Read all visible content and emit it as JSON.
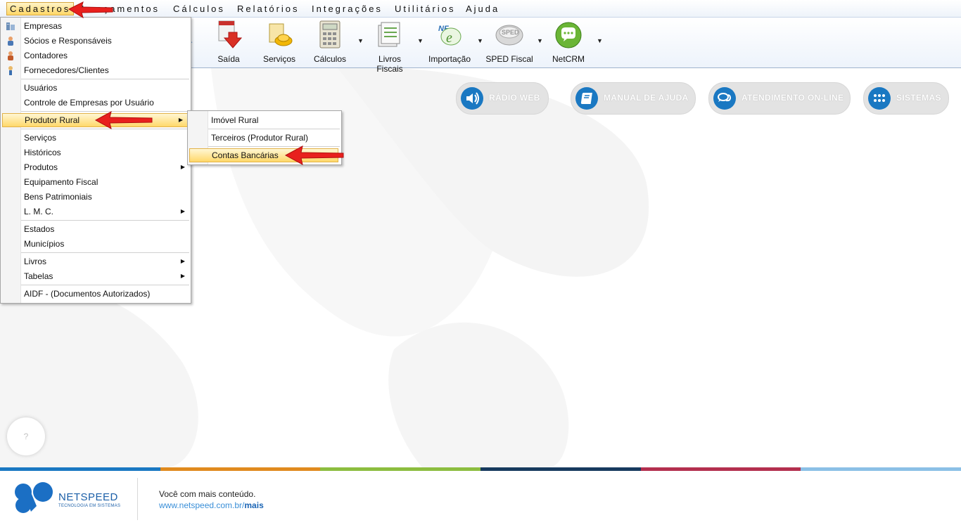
{
  "menubar": {
    "items": [
      {
        "label": "Cadastros"
      },
      {
        "label": "Lançamentos"
      },
      {
        "label": "Cálculos"
      },
      {
        "label": "Relatórios"
      },
      {
        "label": "Integrações"
      },
      {
        "label": "Utilitários"
      },
      {
        "label": "Ajuda"
      }
    ]
  },
  "toolbar": {
    "buttons": [
      {
        "label": "Saída",
        "icon": "exit-document-icon"
      },
      {
        "label": "Serviços",
        "icon": "services-icon"
      },
      {
        "label": "Cálculos",
        "icon": "calculator-icon"
      },
      {
        "label": "Livros Fiscais",
        "icon": "fiscal-books-icon"
      },
      {
        "label": "Importação",
        "icon": "nfe-import-icon"
      },
      {
        "label": "SPED Fiscal",
        "icon": "sped-disc-icon"
      },
      {
        "label": "NetCRM",
        "icon": "chat-bubble-icon"
      }
    ]
  },
  "quick_links": [
    {
      "label": "RÁDIO WEB",
      "icon": "speaker-icon"
    },
    {
      "label": "MANUAL DE AJUDA",
      "icon": "book-icon"
    },
    {
      "label": "ATENDIMENTO ON-LINE",
      "icon": "chat-icon"
    },
    {
      "label": "SISTEMAS",
      "icon": "grid-dots-icon"
    }
  ],
  "cadastros_menu": {
    "items": [
      {
        "label": "Empresas",
        "icon": "building-icon"
      },
      {
        "label": "Sócios e Responsáveis",
        "icon": "partners-icon"
      },
      {
        "label": "Contadores",
        "icon": "accountant-icon"
      },
      {
        "label": "Fornecedores/Clientes",
        "icon": "supplier-icon"
      },
      {
        "label": "Usuários"
      },
      {
        "label": "Controle de Empresas por Usuário"
      },
      {
        "label": "Produtor Rural",
        "submenu": true
      },
      {
        "label": "Serviços"
      },
      {
        "label": "Históricos"
      },
      {
        "label": "Produtos",
        "submenu": true
      },
      {
        "label": "Equipamento Fiscal"
      },
      {
        "label": "Bens Patrimoniais"
      },
      {
        "label": "L. M. C.",
        "submenu": true
      },
      {
        "label": "Estados"
      },
      {
        "label": "Municípios"
      },
      {
        "label": "Livros",
        "submenu": true
      },
      {
        "label": "Tabelas",
        "submenu": true
      },
      {
        "label": "AIDF - (Documentos Autorizados)"
      }
    ]
  },
  "produtor_rural_submenu": {
    "items": [
      {
        "label": "Imóvel Rural"
      },
      {
        "label": "Terceiros (Produtor Rural)"
      },
      {
        "label": "Contas Bancárias"
      }
    ]
  },
  "help": {
    "label": "?"
  },
  "footer": {
    "brand": "NETSPEED",
    "tagline": "TECNOLOGIA EM SISTEMAS",
    "slogan": "Você com mais conteúdo.",
    "link_prefix": "www.netspeed.com.br/",
    "link_suffix": "mais"
  },
  "colors": {
    "accent_blue": "#1a78c2",
    "menu_highlight": "#ffd86a",
    "pointer_red": "#e8201e",
    "stripe": [
      "#1a78c2",
      "#e08a1e",
      "#8cbd3f",
      "#173a5e",
      "#b32f4e",
      "#8bc0e6"
    ]
  }
}
